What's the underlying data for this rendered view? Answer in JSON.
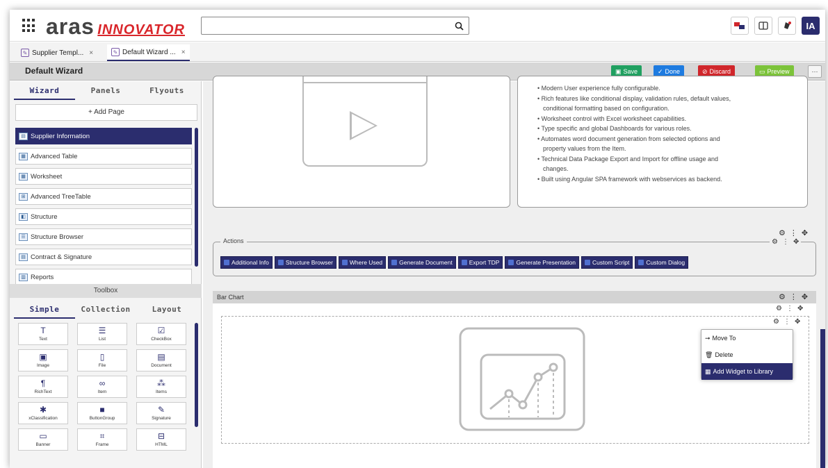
{
  "brand": {
    "logo_main": "aras",
    "logo_sub": "INNOVATOR"
  },
  "search": {
    "value": "",
    "icon": "search-icon"
  },
  "top_icons": [
    "workflow-icon",
    "panel-toggle-icon",
    "notifications-icon"
  ],
  "user": {
    "initials": "IA"
  },
  "tabs": [
    {
      "label": "Supplier Templ...",
      "close": "×"
    },
    {
      "label": "Default Wizard ...",
      "close": "×"
    }
  ],
  "titlebar": {
    "title": "Default Wizard",
    "save": "Save",
    "done": "Done",
    "discard": "Discard",
    "preview": "Preview",
    "more": "···"
  },
  "left": {
    "tabs": [
      "Wizard",
      "Panels",
      "Flyouts"
    ],
    "add_page": "+ Add Page",
    "pages": [
      "Supplier Information",
      "Advanced Table",
      "Worksheet",
      "Advanced TreeTable",
      "Structure",
      "Structure Browser",
      "Contract & Signature",
      "Reports"
    ],
    "toolbox_title": "Toolbox",
    "toolbox_tabs": [
      "Simple",
      "Collection",
      "Layout"
    ],
    "tools": [
      {
        "glyph": "T",
        "label": "Text"
      },
      {
        "glyph": "☰",
        "label": "List"
      },
      {
        "glyph": "☑",
        "label": "CheckBox"
      },
      {
        "glyph": "▣",
        "label": "Image"
      },
      {
        "glyph": "▯",
        "label": "File"
      },
      {
        "glyph": "▤",
        "label": "Document"
      },
      {
        "glyph": "¶",
        "label": "RichText"
      },
      {
        "glyph": "∞",
        "label": "Item"
      },
      {
        "glyph": "⁂",
        "label": "Items"
      },
      {
        "glyph": "✱",
        "label": "xClassification"
      },
      {
        "glyph": "■",
        "label": "ButtonGroup"
      },
      {
        "glyph": "✎",
        "label": "Signature"
      },
      {
        "glyph": "▭",
        "label": "Banner"
      },
      {
        "glyph": "⌗",
        "label": "Frame"
      },
      {
        "glyph": "⊟",
        "label": "HTML"
      }
    ]
  },
  "features": [
    "• Modern User experience fully configurable.",
    "• Rich features like conditional display, validation rules, default values,",
    "  conditional formatting based on configuration.",
    "• Worksheet control with Excel worksheet capabilities.",
    "• Type specific and global Dashboards for various roles.",
    "• Automates word document generation from selected options and",
    "  property values from the Item.",
    "• Technical Data Package Export and Import for offline usage and",
    "  changes.",
    "• Built using Angular SPA framework with webservices as backend."
  ],
  "widget_tools": {
    "gear": "⚙",
    "more": "⋮",
    "move": "✥"
  },
  "actions": {
    "legend": "Actions",
    "buttons": [
      "Additional Info",
      "Structure Browser",
      "Where Used",
      "Generate Document",
      "Export TDP",
      "Generate Presentation",
      "Custom Script",
      "Custom Dialog"
    ]
  },
  "bar_chart": {
    "title": "Bar Chart"
  },
  "context_menu": {
    "items": [
      {
        "icon": "arrow-right-icon",
        "label": "Move To"
      },
      {
        "icon": "trash-icon",
        "label": "Delete"
      },
      {
        "icon": "library-icon",
        "label": "Add Widget to Library"
      }
    ]
  }
}
